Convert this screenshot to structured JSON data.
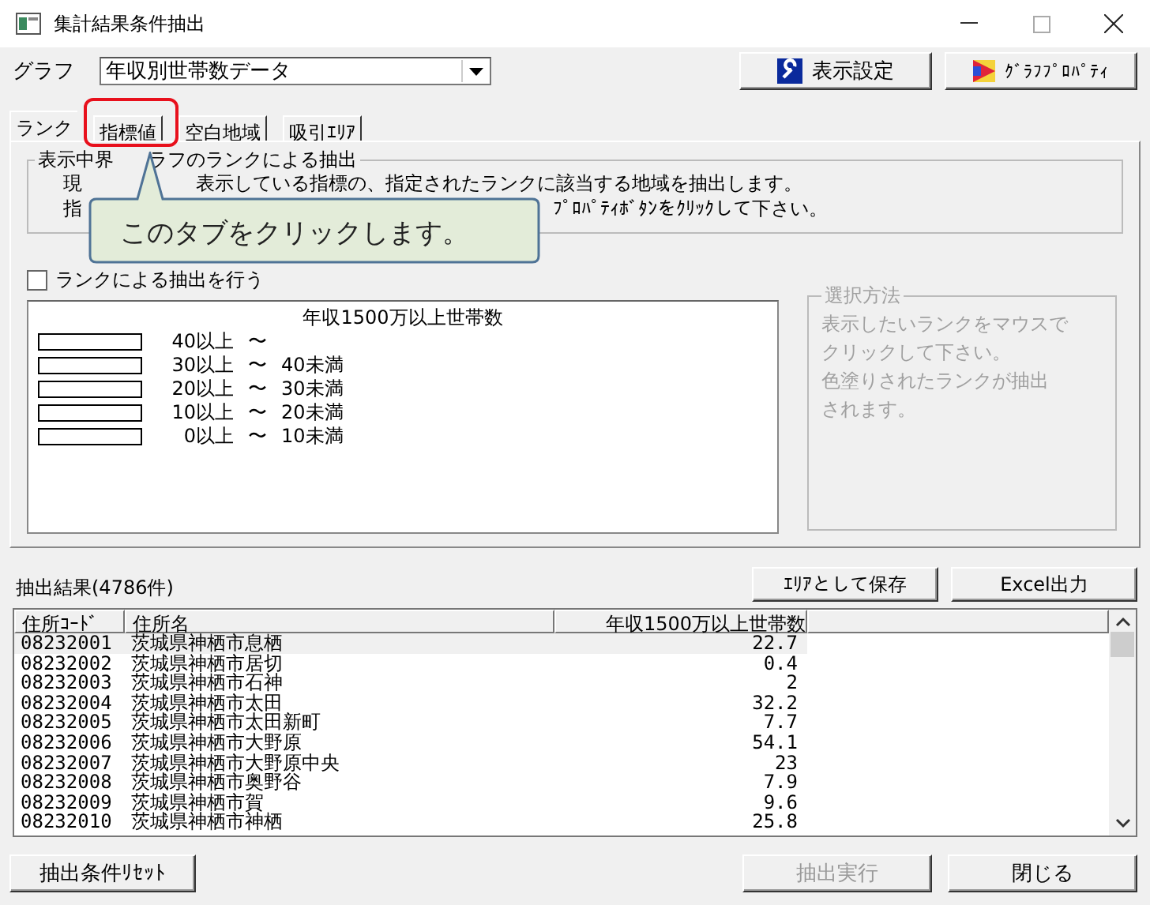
{
  "window": {
    "title": "集計結果条件抽出"
  },
  "graph": {
    "label": "グラフ",
    "value": "年収別世帯数データ"
  },
  "toolbar_buttons": [
    {
      "label": "表示設定",
      "kind": "settings"
    },
    {
      "label": "ｸﾞﾗﾌﾌﾟﾛﾊﾟﾃｨ",
      "kind": "chart"
    }
  ],
  "tabs": [
    {
      "label": "ランク",
      "selected": true
    },
    {
      "label": "指標値",
      "selected": false
    },
    {
      "label": "空白地域",
      "selected": false
    },
    {
      "label": "吸引ｴﾘｱ",
      "selected": false
    }
  ],
  "rank_group": {
    "title_parts": [
      "表示中界",
      "ラフのランクによる抽出"
    ],
    "lines": [
      [
        "現",
        "表示している指標の、指定されたランクに該当する地域を抽出します。"
      ],
      [
        "指",
        "ﾌﾟﾛﾊﾟﾃｨﾎﾞﾀﾝをｸﾘｯｸして下さい。"
      ]
    ]
  },
  "rank_checkbox": {
    "label": "ランクによる抽出を行う",
    "checked": false
  },
  "legend": {
    "title": "年収1500万以上世帯数",
    "ranks": [
      {
        "from": "40以上",
        "sep": "〜"
      },
      {
        "from": "30以上",
        "sep": "〜",
        "to": "40未満"
      },
      {
        "from": "20以上",
        "sep": "〜",
        "to": "30未満"
      },
      {
        "from": "10以上",
        "sep": "〜",
        "to": "20未満"
      },
      {
        "from": "0以上",
        "sep": "〜",
        "to": "10未満"
      }
    ]
  },
  "method_group": {
    "title": "選択方法",
    "disabled": true,
    "lines": [
      "表示したいランクをマウスで",
      "クリックして下さい。",
      "色塗りされたランクが抽出",
      "されます。"
    ]
  },
  "results": {
    "label": "抽出結果(4786件)",
    "buttons": [
      "ｴﾘｱとして保存",
      "Excel出力"
    ],
    "columns": [
      "住所ｺｰﾄﾞ",
      "住所名",
      "年収1500万以上世帯数"
    ],
    "rows": [
      {
        "cells": [
          "08232001",
          "茨城県神栖市息栖",
          "22.7"
        ],
        "selected": true
      },
      {
        "cells": [
          "08232002",
          "茨城県神栖市居切",
          "0.4"
        ],
        "selected": false
      },
      {
        "cells": [
          "08232003",
          "茨城県神栖市石神",
          "2"
        ],
        "selected": false
      },
      {
        "cells": [
          "08232004",
          "茨城県神栖市太田",
          "32.2"
        ],
        "selected": false
      },
      {
        "cells": [
          "08232005",
          "茨城県神栖市太田新町",
          "7.7"
        ],
        "selected": false
      },
      {
        "cells": [
          "08232006",
          "茨城県神栖市大野原",
          "54.1"
        ],
        "selected": false
      },
      {
        "cells": [
          "08232007",
          "茨城県神栖市大野原中央",
          "23"
        ],
        "selected": false
      },
      {
        "cells": [
          "08232008",
          "茨城県神栖市奥野谷",
          "7.9"
        ],
        "selected": false
      },
      {
        "cells": [
          "08232009",
          "茨城県神栖市賀",
          "9.6"
        ],
        "selected": false
      },
      {
        "cells": [
          "08232010",
          "茨城県神栖市神栖",
          "25.8"
        ],
        "selected": false
      }
    ]
  },
  "footer_buttons": [
    {
      "label": "抽出条件ﾘｾｯﾄ",
      "disabled": false
    },
    {
      "label": "抽出実行",
      "disabled": true
    },
    {
      "label": "閉じる",
      "disabled": false
    }
  ],
  "callout": {
    "text": "このタブをクリックします。"
  }
}
